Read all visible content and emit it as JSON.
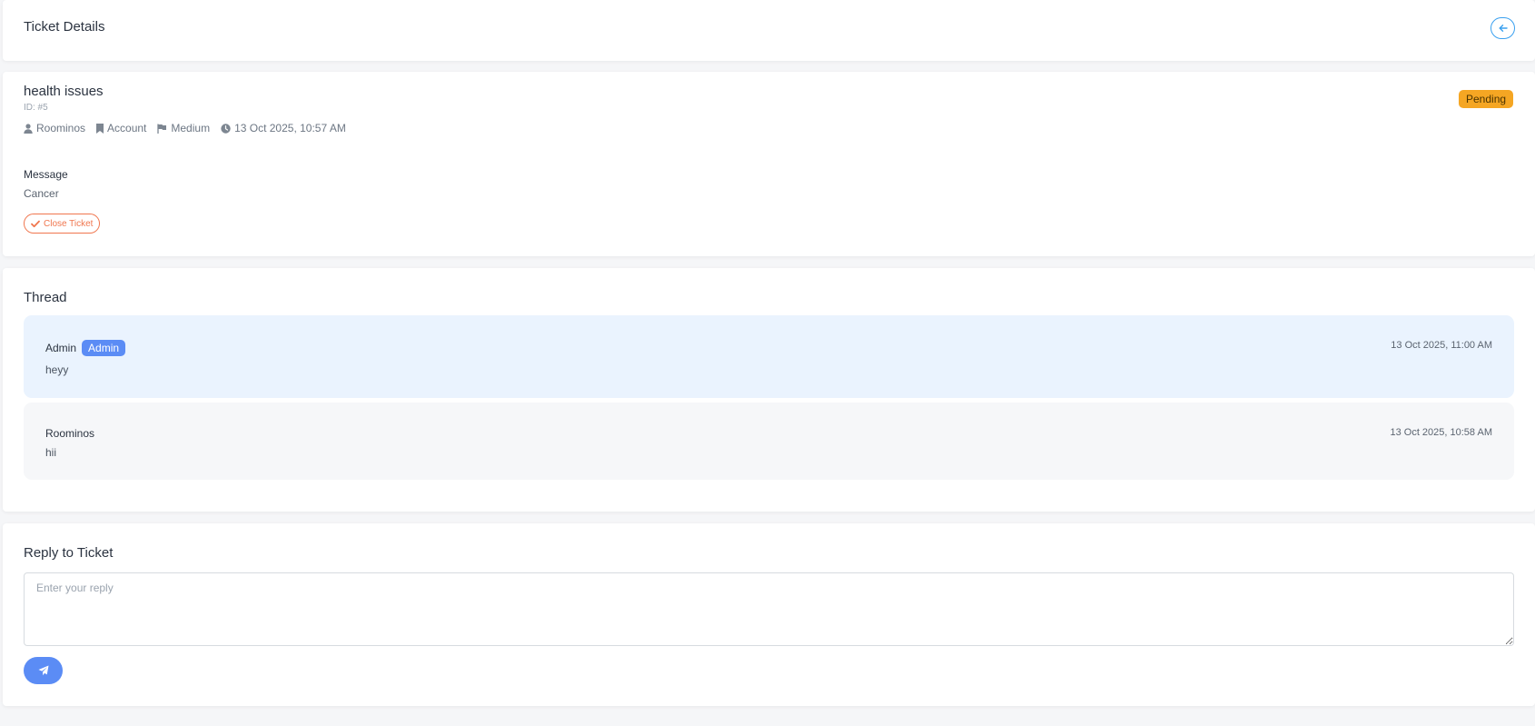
{
  "header": {
    "title": "Ticket Details",
    "back_icon": "arrow-left-icon",
    "accent": "#3aa0ef"
  },
  "ticket": {
    "subject": "health issues",
    "id_label": "ID: #5",
    "status": "Pending",
    "status_color": "#f5a623",
    "meta": {
      "user": "Roominos",
      "category": "Account",
      "priority": "Medium",
      "created": "13 Oct 2025, 10:57 AM"
    },
    "message_label": "Message",
    "message": "Cancer",
    "close_label": "Close Ticket",
    "close_color": "#f0764e"
  },
  "thread": {
    "title": "Thread",
    "messages": [
      {
        "author": "Admin",
        "role": "Admin",
        "time": "13 Oct 2025, 11:00 AM",
        "text": "heyy"
      },
      {
        "author": "Roominos",
        "time": "13 Oct 2025, 10:58 AM",
        "text": "hii"
      }
    ]
  },
  "reply": {
    "title": "Reply to Ticket",
    "placeholder": "Enter your reply",
    "value": "",
    "send_icon": "paper-plane-icon",
    "button_color": "#5b8cf5"
  }
}
